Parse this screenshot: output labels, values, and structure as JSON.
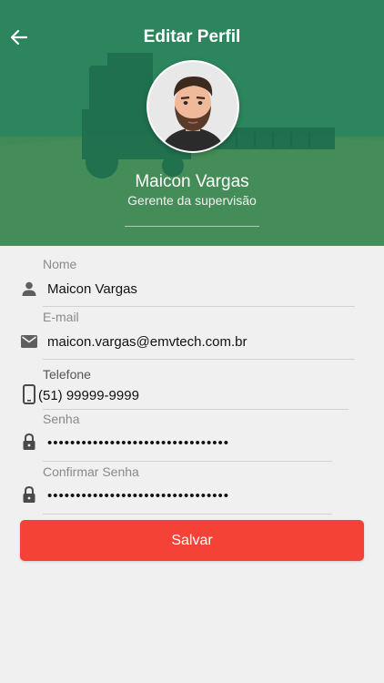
{
  "header": {
    "title": "Editar Perfil",
    "user_name": "Maicon Vargas",
    "user_role": "Gerente da supervisão"
  },
  "form": {
    "nome": {
      "label": "Nome",
      "value": "Maicon Vargas"
    },
    "email": {
      "label": "E-mail",
      "value": "maicon.vargas@emvtech.com.br"
    },
    "telefone": {
      "label": "Telefone",
      "value": "(51) 99999-9999"
    },
    "senha": {
      "label": "Senha",
      "value": "••••••••••••••••••••••••••••••••"
    },
    "confirmar": {
      "label": "Confirmar Senha",
      "value": "••••••••••••••••••••••••••••••••"
    }
  },
  "actions": {
    "save_label": "Salvar"
  },
  "colors": {
    "header": "#2d8a62",
    "primary": "#f44336",
    "background": "#f0f0f0"
  },
  "icons": [
    "back-arrow-icon",
    "person-icon",
    "mail-icon",
    "phone-icon",
    "lock-icon"
  ]
}
